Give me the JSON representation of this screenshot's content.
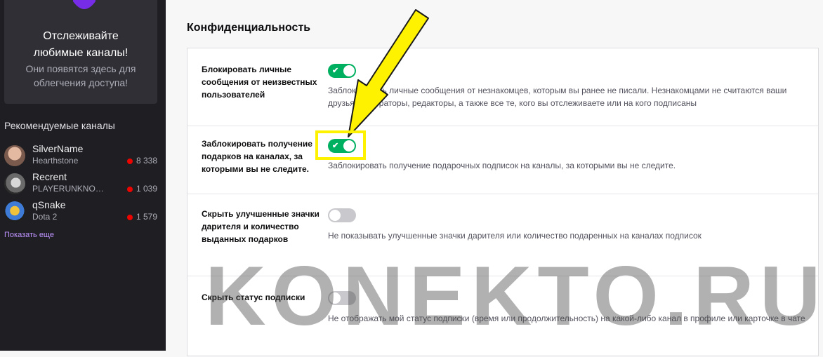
{
  "sidebar": {
    "promo": {
      "title_line1": "Отслеживайте",
      "title_line2": "любимые каналы!",
      "sub_line1": "Они появятся здесь для",
      "sub_line2": "облегчения доступа!"
    },
    "recommended_header": "Рекомендуемые каналы",
    "channels": [
      {
        "name": "SilverName",
        "game": "Hearthstone",
        "viewers": "8 338"
      },
      {
        "name": "Recrent",
        "game": "PLAYERUNKNOWN'S BATTLEGROUNDS",
        "viewers": "1 039"
      },
      {
        "name": "qSnake",
        "game": "Dota 2",
        "viewers": "1 579"
      }
    ],
    "show_more": "Показать еще"
  },
  "main": {
    "section_title": "Конфиденциальность",
    "settings": [
      {
        "label": "Блокировать личные сообщения от неизвестных пользователей",
        "desc": "Заблокировать личные сообщения от незнакомцев, которым вы ранее не писали. Незнакомцами не считаются ваши друзья, модераторы, редакторы, а также все те, кого вы отслеживаете или на кого подписаны",
        "enabled": true
      },
      {
        "label": "Заблокировать получение подарков на каналах, за которыми вы не следите.",
        "desc": "Заблокировать получение подарочных подписок на каналы, за которыми вы не следите.",
        "enabled": true
      },
      {
        "label": "Скрыть улучшенные значки дарителя и количество выданных подарков",
        "desc": "Не показывать улучшенные значки дарителя или количество подаренных на каналах подписок",
        "enabled": false
      },
      {
        "label": "Скрыть статус подписки",
        "desc": "Не отображать мой статус подписки (время или продолжительность) на какой-либо канал в профиле или карточке в чате",
        "enabled": false
      }
    ]
  },
  "watermark": "KONEKTO.RU",
  "colors": {
    "sidebar_bg": "#1f1f23",
    "toggle_on": "#00b061",
    "toggle_off": "#c8c8cd",
    "highlight": "#fff200",
    "live_dot": "#eb0400"
  }
}
